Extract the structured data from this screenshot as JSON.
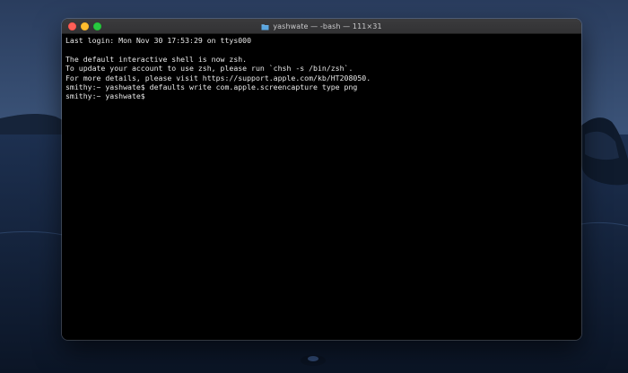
{
  "window": {
    "title": "yashwate — -bash — 111×31",
    "folder_icon": "folder-icon"
  },
  "traffic_lights": {
    "close_color": "#fe5f57",
    "minimize_color": "#febc2e",
    "zoom_color": "#28c840"
  },
  "terminal": {
    "lines": [
      "Last login: Mon Nov 30 17:53:29 on ttys000",
      "",
      "The default interactive shell is now zsh.",
      "To update your account to use zsh, please run `chsh -s /bin/zsh`.",
      "For more details, please visit https://support.apple.com/kb/HT208050.",
      "smithy:~ yashwate$ defaults write com.apple.screencapture type png",
      "smithy:~ yashwate$ "
    ]
  },
  "colors": {
    "terminal_background": "#000000",
    "terminal_text": "#e8e8e8",
    "title_bar": "#363638"
  }
}
